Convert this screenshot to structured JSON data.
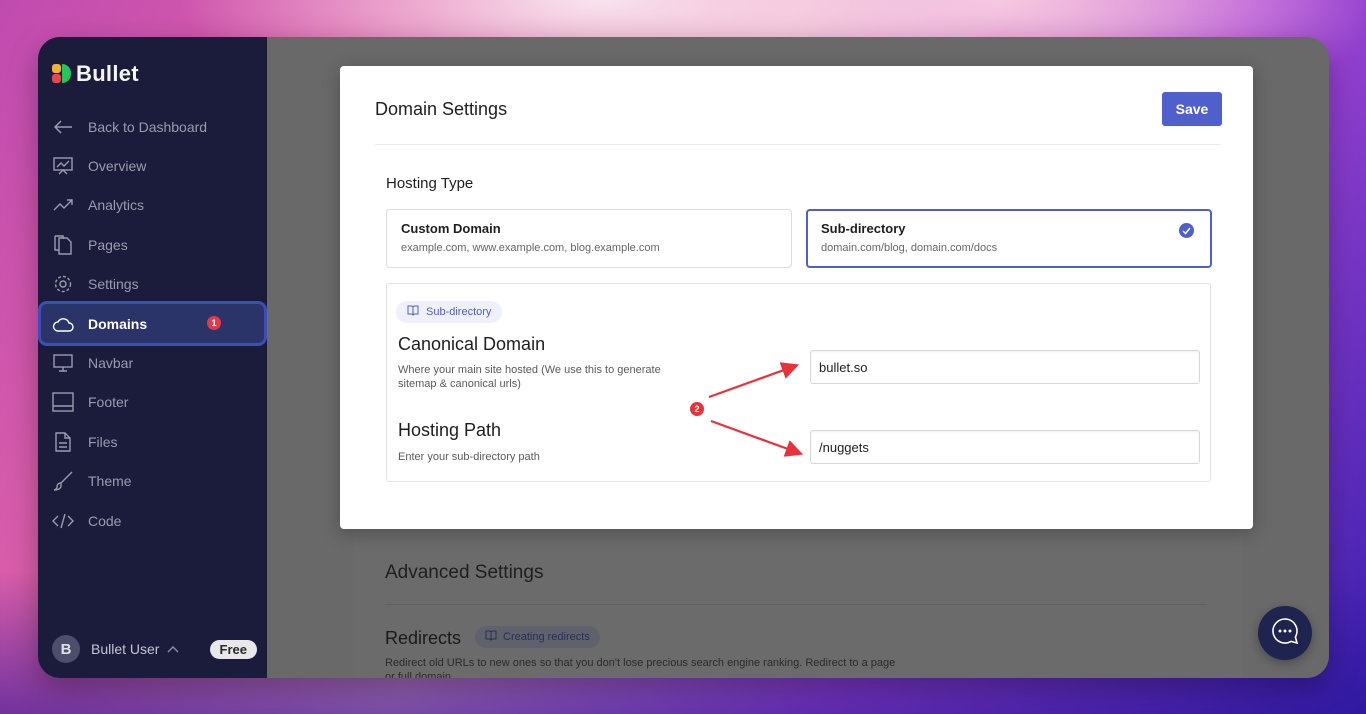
{
  "app": {
    "logo_text": "Bullet",
    "logo_colors": [
      "#f2b134",
      "#e5484d",
      "#3b82f6",
      "#22c55e"
    ]
  },
  "sidebar": {
    "items": [
      {
        "label": "Back to Dashboard",
        "icon": "arrow-left-icon"
      },
      {
        "label": "Overview",
        "icon": "chart-board-icon"
      },
      {
        "label": "Analytics",
        "icon": "trend-line-icon"
      },
      {
        "label": "Pages",
        "icon": "pages-icon"
      },
      {
        "label": "Settings",
        "icon": "gear-icon"
      },
      {
        "label": "Domains",
        "icon": "cloud-icon",
        "active": true,
        "badge": "1"
      },
      {
        "label": "Navbar",
        "icon": "monitor-icon"
      },
      {
        "label": "Footer",
        "icon": "footer-icon"
      },
      {
        "label": "Files",
        "icon": "file-icon"
      },
      {
        "label": "Theme",
        "icon": "brush-icon"
      },
      {
        "label": "Code",
        "icon": "code-icon"
      }
    ],
    "user": {
      "initial": "B",
      "name": "Bullet User",
      "plan": "Free"
    }
  },
  "modal": {
    "title": "Domain Settings",
    "save_label": "Save",
    "hosting_type_label": "Hosting Type",
    "options": [
      {
        "title": "Custom Domain",
        "subtitle": "example.com, www.example.com, blog.example.com",
        "selected": false
      },
      {
        "title": "Sub-directory",
        "subtitle": "domain.com/blog, domain.com/docs",
        "selected": true
      }
    ],
    "chip_label": "Sub-directory",
    "canonical": {
      "title": "Canonical Domain",
      "desc": "Where your main site hosted (We use this to generate sitemap & canonical urls)",
      "value": "bullet.so"
    },
    "hosting_path": {
      "title": "Hosting Path",
      "desc": "Enter your sub-directory path",
      "value": "/nuggets"
    },
    "annotation_number": "2"
  },
  "background": {
    "advanced_title": "Advanced Settings",
    "redirects_title": "Redirects",
    "redirects_chip": "Creating redirects",
    "redirects_desc": "Redirect old URLs to new ones so that you don't lose precious search engine ranking. Redirect to a page or full domain."
  },
  "colors": {
    "accent": "#4f5fcc",
    "sidebar_bg": "#1b1c3b",
    "badge": "#e23a4a",
    "annotation": "#e8313a"
  }
}
